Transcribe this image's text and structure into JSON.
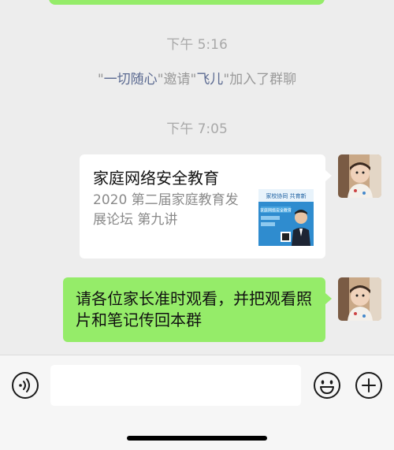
{
  "chat": {
    "timestamp_1": "下午 5:16",
    "system_message": {
      "quote_open": "\"",
      "inviter": "一切随心",
      "mid": "\"邀请\"",
      "invitee": "飞儿",
      "tail": "\"加入了群聊"
    },
    "timestamp_2": "下午 7:05",
    "link_card": {
      "title": "家庭网络安全教育",
      "description": "2020 第二届家庭教育发展论坛 第九讲",
      "thumb_header": "家校协同 共育新",
      "thumb_caption": "家庭网络安全教育"
    },
    "text_message": "请各位家长准时观看，并把观看照片和笔记传回本群"
  },
  "input_bar": {
    "voice_icon": "voice-icon",
    "emoji_icon": "emoji-icon",
    "plus_icon": "plus-icon",
    "input_value": ""
  },
  "colors": {
    "background": "#ededed",
    "bubble_green": "#95ec69",
    "system_name": "#5b6a91"
  }
}
